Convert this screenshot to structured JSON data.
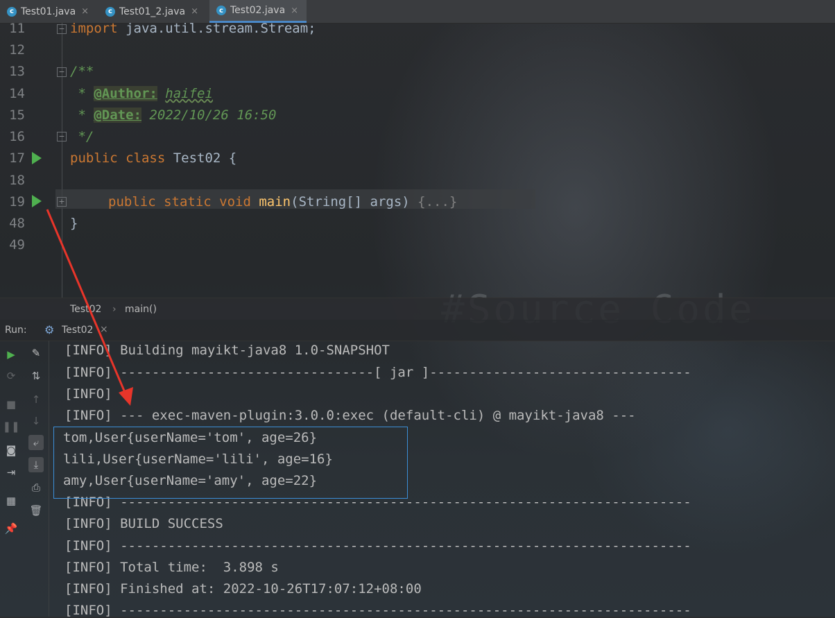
{
  "tabs": [
    {
      "label": "Test01.java",
      "icon": "java-class-icon",
      "active": false
    },
    {
      "label": "Test01_2.java",
      "icon": "java-class-icon",
      "active": false
    },
    {
      "label": "Test02.java",
      "icon": "java-class-icon",
      "active": true
    }
  ],
  "editor": {
    "line_numbers": [
      "11",
      "12",
      "13",
      "14",
      "15",
      "16",
      "17",
      "18",
      "19",
      "48",
      "49"
    ],
    "import_kw": "import",
    "import_rest": " java.util.stream.Stream;",
    "doc_open": "/**",
    "doc_star": " * ",
    "author_tag": "@Author:",
    "author_value": "haifei",
    "date_tag": "@Date:",
    "date_value": "2022/10/26 16:50",
    "doc_close": " */",
    "class_kw": "public class",
    "class_name": " Test02 {",
    "method_kw": "public static void",
    "method_name": "main",
    "method_params": "(String[] args)",
    "method_fold": "{...}",
    "close_brace": "}"
  },
  "breadcrumb": {
    "items": [
      "Test02",
      "main()"
    ],
    "separator": "›"
  },
  "run_panel": {
    "label": "Run:",
    "tab": "Test02",
    "close": "×"
  },
  "console": {
    "lines": [
      "[INFO] Building mayikt-java8 1.0-SNAPSHOT",
      "[INFO] --------------------------------[ jar ]---------------------------------",
      "[INFO]",
      "[INFO] --- exec-maven-plugin:3.0.0:exec (default-cli) @ mayikt-java8 ---",
      "tom,User{userName='tom', age=26}",
      "lili,User{userName='lili', age=16}",
      "amy,User{userName='amy', age=22}",
      "[INFO] ------------------------------------------------------------------------",
      "[INFO] BUILD SUCCESS",
      "[INFO] ------------------------------------------------------------------------",
      "[INFO] Total time:  3.898 s",
      "[INFO] Finished at: 2022-10-26T17:07:12+08:00",
      "[INFO] ------------------------------------------------------------------------"
    ]
  },
  "background_watermark": "#Source Code",
  "colors": {
    "keyword": "#cc7832",
    "comment": "#629755",
    "method": "#ffc66d",
    "text": "#a9b7c6",
    "highlight_box": "#3c8fd8",
    "annotation_arrow": "#e8352a",
    "run_green": "#4fb04f"
  }
}
